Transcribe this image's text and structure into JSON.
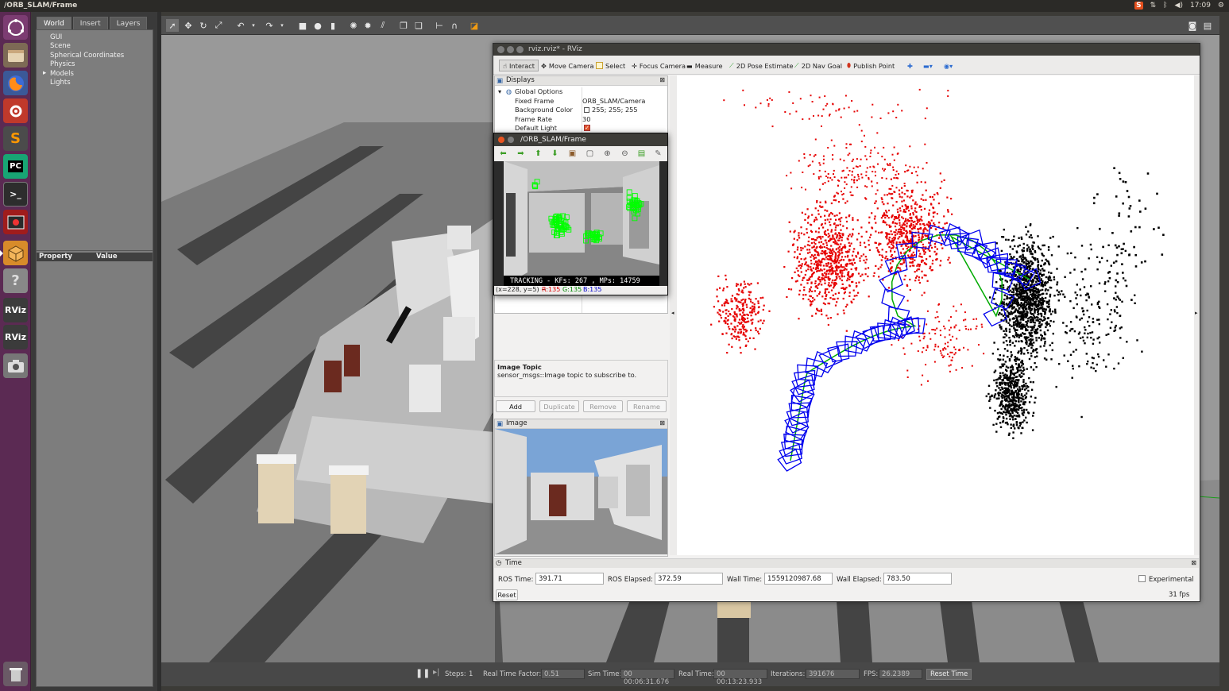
{
  "topbar": {
    "title": "/ORB_SLAM/Frame",
    "time": "17:09",
    "tray_icons": [
      "sublime-tray-icon",
      "network-icon",
      "bluetooth-icon",
      "volume-icon",
      "settings-icon"
    ]
  },
  "launcher": {
    "items": [
      "ubuntu-dash-icon",
      "files-icon",
      "firefox-icon",
      "system-settings-icon",
      "sublime-text-icon",
      "pycharm-icon",
      "terminal-icon",
      "screen-recorder-icon",
      "gazebo-icon",
      "help-icon",
      "rviz-icon",
      "rviz-icon-2",
      "camera-icon",
      "trash-icon"
    ],
    "sublime_letter": "S",
    "pycharm_letters": "PC",
    "terminal_prompt": ">_",
    "help_mark": "?",
    "rviz_label": "RViz",
    "rviz2_label": "RViz"
  },
  "gazebo": {
    "tabs": [
      "World",
      "Insert",
      "Layers"
    ],
    "tree_items": [
      "GUI",
      "Scene",
      "Spherical Coordinates",
      "Physics",
      "Models",
      "Lights"
    ],
    "props_header": {
      "property": "Property",
      "value": "Value"
    },
    "bottom": {
      "steps_label": "Steps:",
      "steps_value": "1",
      "rtf_label": "Real Time Factor:",
      "rtf_value": "0.51",
      "sim_time_label": "Sim Time:",
      "sim_time_value": "00 00:06:31.676",
      "real_time_label": "Real Time:",
      "real_time_value": "00 00:13:23.933",
      "iterations_label": "Iterations:",
      "iterations_value": "391676",
      "fps_label": "FPS:",
      "fps_value": "26.2389",
      "reset_time": "Reset Time"
    }
  },
  "rviz": {
    "title": "rviz.rviz* - RViz",
    "tools": [
      "Interact",
      "Move Camera",
      "Select",
      "Focus Camera",
      "Measure",
      "2D Pose Estimate",
      "2D Nav Goal",
      "Publish Point"
    ],
    "displays": {
      "title": "Displays",
      "global_options": "Global Options",
      "rows": [
        {
          "key": "Fixed Frame",
          "value": "ORB_SLAM/Camera"
        },
        {
          "key": "Background Color",
          "value": "255; 255; 255"
        },
        {
          "key": "Frame Rate",
          "value": "30"
        },
        {
          "key": "Default Light",
          "value": ""
        }
      ]
    },
    "description": {
      "title": "Image Topic",
      "text": "sensor_msgs::Image topic to subscribe to."
    },
    "buttons": [
      "Add",
      "Duplicate",
      "Remove",
      "Rename"
    ],
    "image_panel": {
      "title": "Image"
    },
    "time": {
      "title": "Time",
      "ros_time_label": "ROS Time:",
      "ros_time": "391.71",
      "ros_elapsed_label": "ROS Elapsed:",
      "ros_elapsed": "372.59",
      "wall_time_label": "Wall Time:",
      "wall_time": "1559120987.68",
      "wall_elapsed_label": "Wall Elapsed:",
      "wall_elapsed": "783.50",
      "experimental": "Experimental",
      "reset": "Reset",
      "fps": "31 fps"
    }
  },
  "orb": {
    "title": "/ORB_SLAM/Frame",
    "overlay": "TRACKING  - KFs: 267 , MPs: 14759",
    "coords": "(x=228, y=5) ~",
    "r": "R:135",
    "g": "G:135",
    "b": "B:135"
  },
  "colors": {
    "map_points_red": "#e60000",
    "map_points_black": "#000000",
    "keyframes_blue": "#0000ee",
    "graph_green": "#00aa00",
    "orb_features": "#00ff00"
  }
}
